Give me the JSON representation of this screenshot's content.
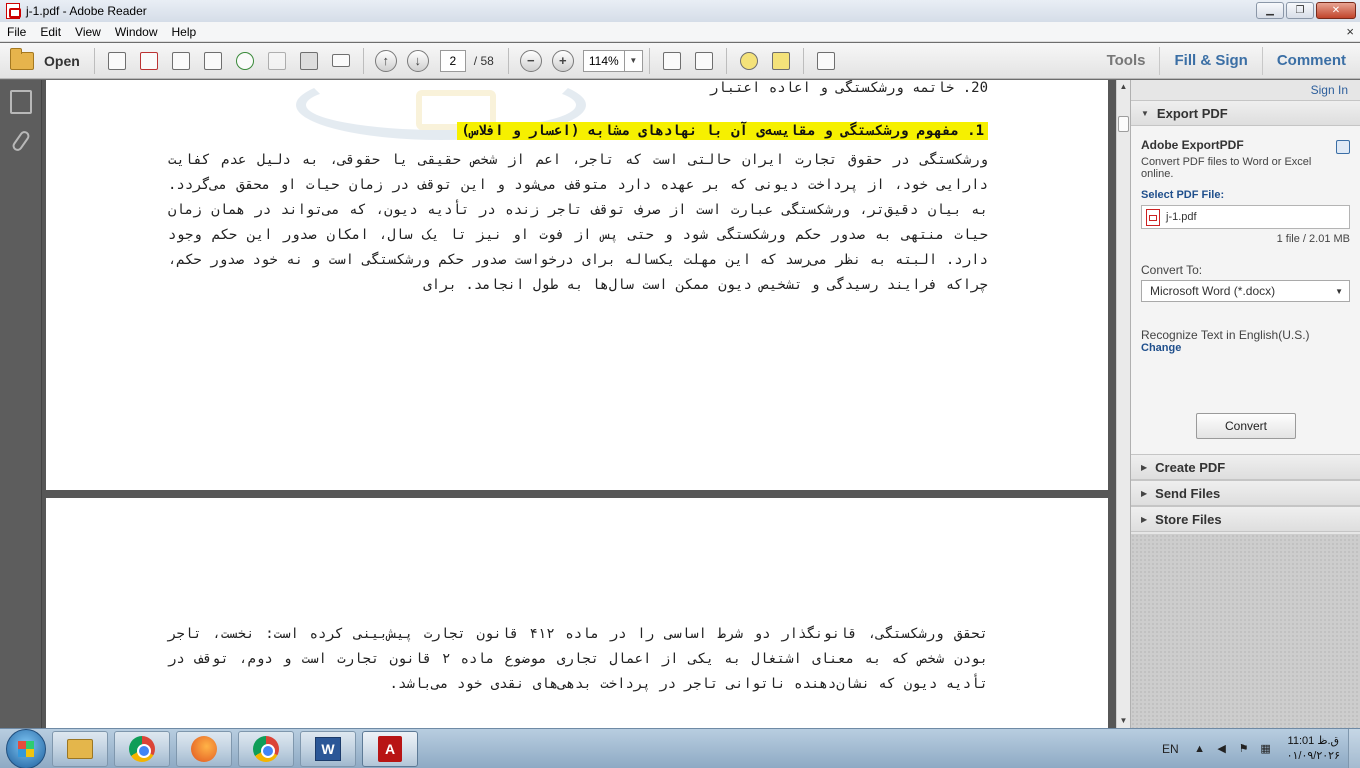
{
  "window": {
    "title": "j-1.pdf - Adobe Reader",
    "min_symbol": "▁",
    "max_symbol": "❐",
    "close_symbol": "✕"
  },
  "menu": {
    "items": [
      "File",
      "Edit",
      "View",
      "Window",
      "Help"
    ],
    "close_symbol": "×"
  },
  "toolbar": {
    "open_label": "Open",
    "page_current": "2",
    "page_total": "/ 58",
    "zoom_value": "114%",
    "zoom_out_symbol": "−",
    "zoom_in_symbol": "+",
    "prev_symbol": "↑",
    "next_symbol": "↓",
    "dropdown_symbol": "▼",
    "tools_label": "Tools",
    "fill_sign_label": "Fill & Sign",
    "comment_label": "Comment"
  },
  "document": {
    "previous_line": "20. خاتمه ورشكستگی و اعاده اعتبار",
    "heading": "1.  مفهوم ورشكستگی و مقایسه‌ی آن با نهادهای مشابه (اعسار و افلاس)",
    "para1": "ورشکستگی در حقوق تجارت ایران حالتی است که تاجر، اعم از شخص حقیقی یا حقوقی، به دلیل عدم کفایت دارایی خود، از پرداخت دیونی که بر عهده دارد متوقف می‌شود و این توقف در زمان حیات او محقق می‌گردد. به بیان دقیق‌تر، ورشکستگی عبارت است از صرف توقف تاجر زنده در تأدیه دیون، که می‌تواند در همان زمان حیات منتهی به صدور حکم ورشکستگی شود و حتی پس از فوت او نیز تا یک سال، امکان صدور این حکم وجود دارد. البته به نظر می‌رسد که این مهلت یکساله برای درخواست صدور حکم ورشکستگی است و نه خود صدور حکم، چراکه فرایند رسیدگی و تشخیص دیون ممکن است سال‌ها به طول انجامد. برای",
    "para2": "تحقق ورشکستگی، قانونگذار دو شرط اساسی را در ماده ۴۱۲ قانون تجارت پیش‌بینی کرده است: نخست، تاجر بودن شخص که به معنای اشتغال به یکی از اعمال تجاری موضوع ماده ۲ قانون تجارت است و دوم، توقف در تأدیه دیون که نشان‌دهنده ناتوانی تاجر در پرداخت بدهی‌های نقدی خود می‌باشد."
  },
  "scrollbar": {
    "up_symbol": "▲",
    "down_symbol": "▼"
  },
  "right_panel": {
    "sign_in": "Sign In",
    "export_header": "Export PDF",
    "export_title": "Adobe ExportPDF",
    "export_desc": "Convert PDF files to Word or Excel online.",
    "select_label": "Select PDF File:",
    "file_name": "j-1.pdf",
    "file_meta": "1 file / 2.01 MB",
    "convert_to_label": "Convert To:",
    "convert_to_value": "Microsoft Word (*.docx)",
    "ocr_label": "Recognize Text in English(U.S.)",
    "change_link": "Change",
    "convert_button": "Convert",
    "create_pdf": "Create PDF",
    "send_files": "Send Files",
    "store_files": "Store Files",
    "expanded_triangle": "▼",
    "collapsed_triangle": "▶"
  },
  "taskbar": {
    "word_letter": "W",
    "acrobat_letter": "A",
    "lang": "EN",
    "tray_up": "▲",
    "tray_flag": "⚑",
    "tray_volume": "◀",
    "tray_network": "▦",
    "clock_time": "11:01 ق.ظ",
    "clock_date": "۰۱/۰۹/۲۰۲۶"
  },
  "colors": {
    "highlight": "#f6f000",
    "accent_blue": "#3b6fa5",
    "link_blue": "#1f4f8c"
  }
}
